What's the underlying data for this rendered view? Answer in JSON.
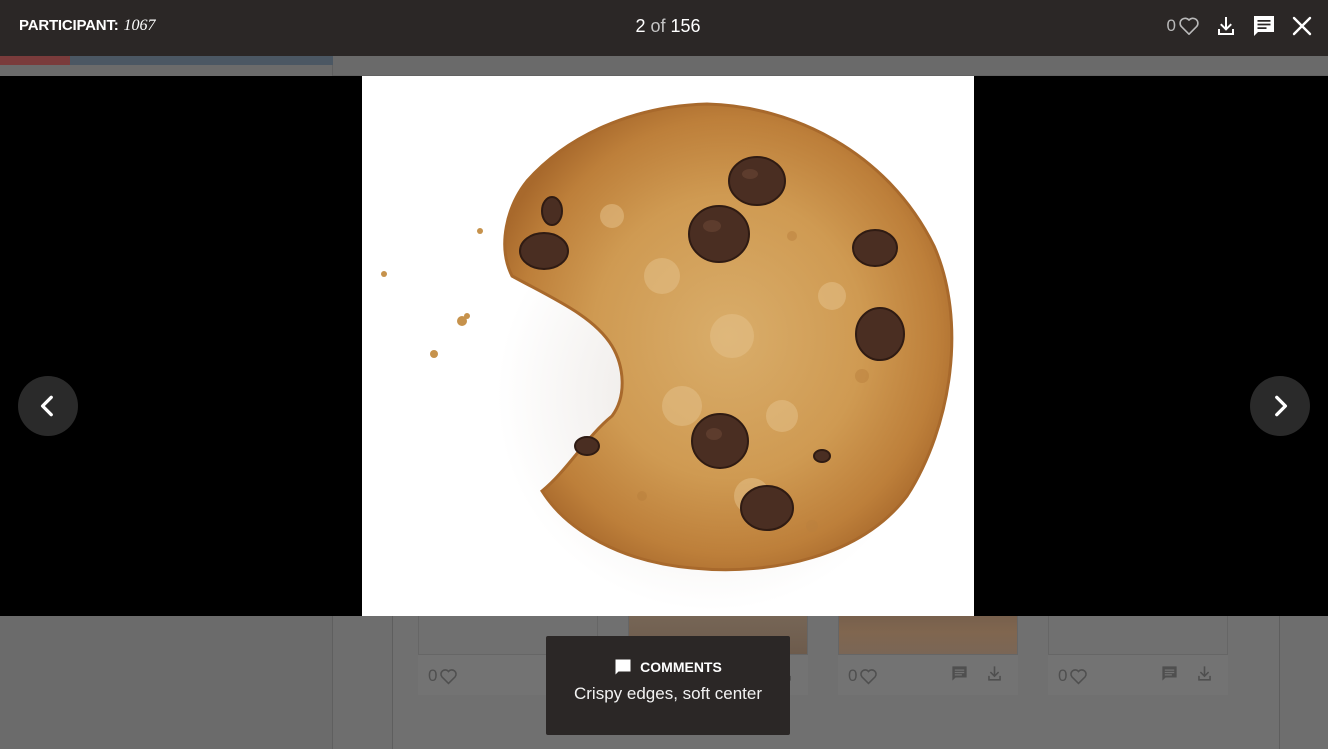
{
  "header": {
    "participant_label": "PARTICIPANT:",
    "participant_id": "1067",
    "pager": {
      "current": "2",
      "separator": "of",
      "total": "156"
    },
    "likes_count": "0"
  },
  "photo": {
    "alt": "Chocolate chip cookie with a bite taken out"
  },
  "comments": {
    "title": "COMMENTS",
    "text": "Crispy edges, soft center"
  },
  "background_cards": [
    {
      "likes": "0"
    },
    {
      "likes": ""
    },
    {
      "likes": "0"
    },
    {
      "likes": "0"
    }
  ],
  "colors": {
    "header_bg": "#2b2726",
    "stage_bg": "#000000",
    "overlay_bg": "#6e6e6e"
  }
}
